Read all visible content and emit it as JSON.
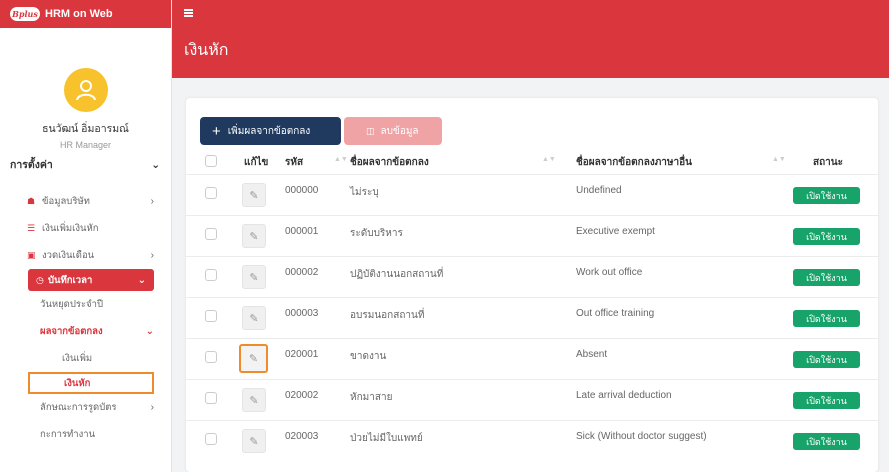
{
  "app": {
    "title": "HRM on Web",
    "logo_text": "Bplus"
  },
  "user": {
    "name": "ธนวัฒน์ อิ่มอารมณ์",
    "role": "HR Manager"
  },
  "sidebar": {
    "section_title": "การตั้งค่า",
    "items": [
      {
        "label": "ข้อมูลบริษัท"
      },
      {
        "label": "เงินเพิ่มเงินหัก"
      },
      {
        "label": "งวดเงินเดือน"
      },
      {
        "label": "บันทึกเวลา"
      },
      {
        "label": "วันหยุดประจำปี"
      },
      {
        "label": "ผลจากข้อตกลง"
      },
      {
        "label": "เงินเพิ่ม"
      },
      {
        "label": "เงินหัก"
      },
      {
        "label": "ลักษณะการรูดบัตร"
      },
      {
        "label": "กะการทำงาน"
      }
    ]
  },
  "page": {
    "title": "เงินหัก"
  },
  "toolbar": {
    "add_label": "เพิ่มผลจากข้อตกลง",
    "delete_label": "ลบข้อมูล"
  },
  "table": {
    "headers": {
      "edit": "แก้ไข",
      "code": "รหัส",
      "name": "ชื่อผลจากข้อตกลง",
      "name_other": "ชื่อผลจากข้อตกลงภาษาอื่น",
      "status": "สถานะ"
    },
    "rows": [
      {
        "code": "000000",
        "name": "ไม่ระบุ",
        "name_other": "Undefined",
        "status": "เปิดใช้งาน"
      },
      {
        "code": "000001",
        "name": "ระดับบริหาร",
        "name_other": "Executive exempt",
        "status": "เปิดใช้งาน"
      },
      {
        "code": "000002",
        "name": "ปฏิบัติงานนอกสถานที่",
        "name_other": "Work out office",
        "status": "เปิดใช้งาน"
      },
      {
        "code": "000003",
        "name": "อบรมนอกสถานที่",
        "name_other": "Out office training",
        "status": "เปิดใช้งาน"
      },
      {
        "code": "020001",
        "name": "ขาดงาน",
        "name_other": "Absent",
        "status": "เปิดใช้งาน"
      },
      {
        "code": "020002",
        "name": "หักมาสาย",
        "name_other": "Late arrival deduction",
        "status": "เปิดใช้งาน"
      },
      {
        "code": "020003",
        "name": "ป่วยไม่มีใบแพทย์",
        "name_other": "Sick (Without doctor suggest)",
        "status": "เปิดใช้งาน"
      }
    ]
  },
  "colors": {
    "primary_red": "#d9363e",
    "navy": "#1f3a5e",
    "green": "#18a36b",
    "highlight": "#ef8b2b"
  }
}
